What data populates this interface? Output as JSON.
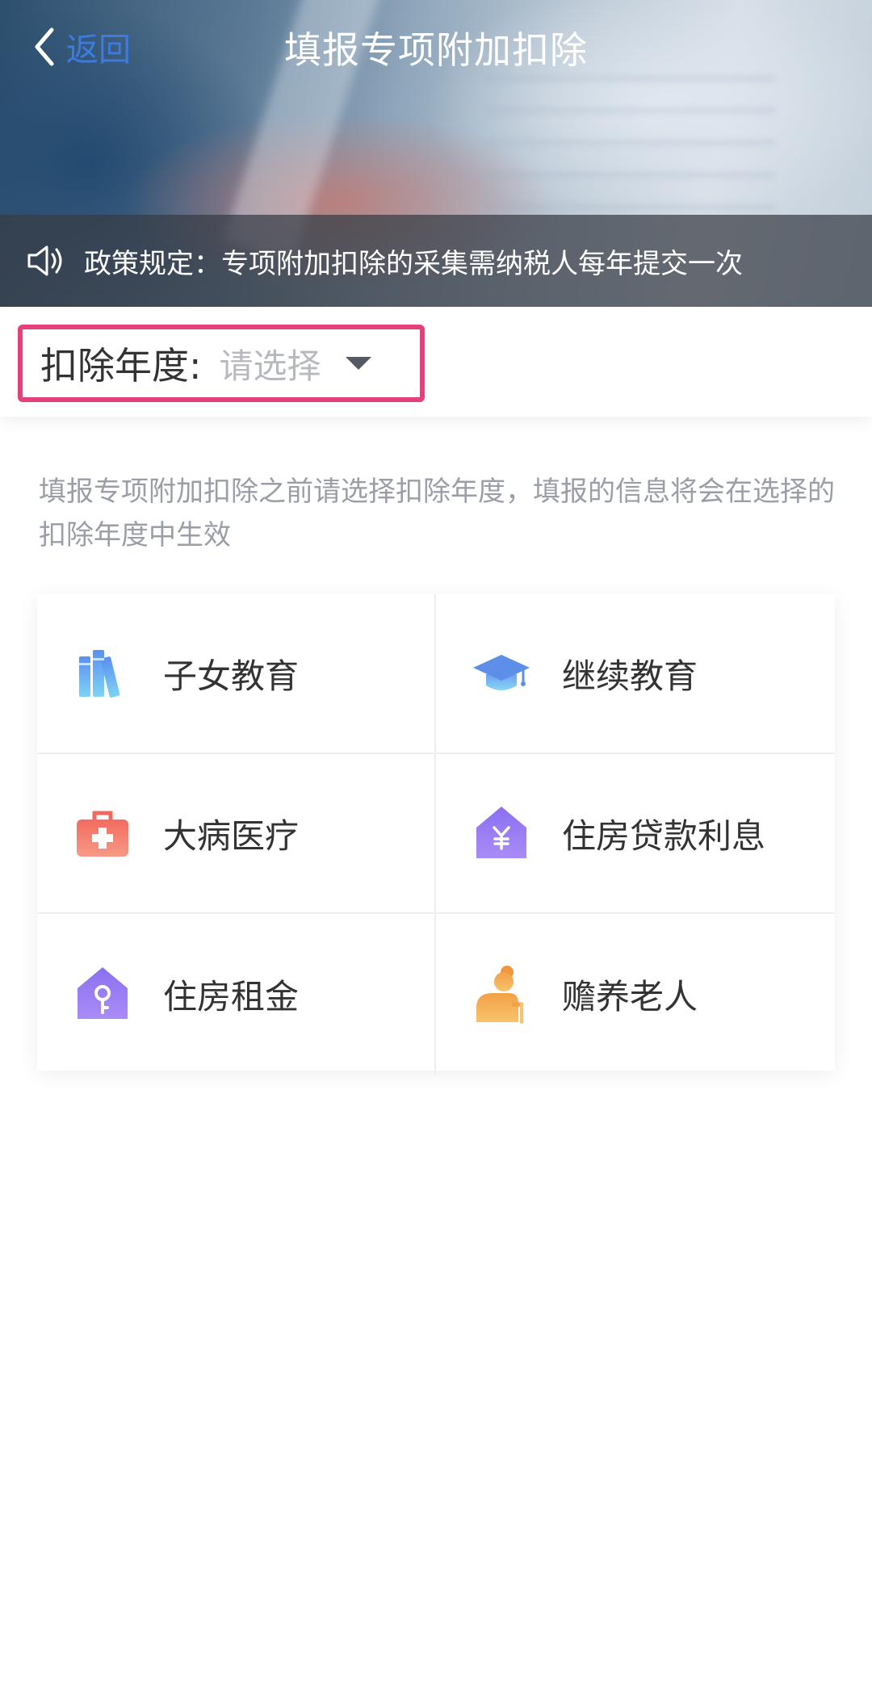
{
  "header": {
    "back_label": "返回",
    "title": "填报专项附加扣除"
  },
  "notice": {
    "icon": "speaker-icon",
    "text": "政策规定：专项附加扣除的采集需纳税人每年提交一次"
  },
  "year_selector": {
    "label": "扣除年度:",
    "placeholder": "请选择",
    "highlight_color": "#e2417c"
  },
  "hint": "填报专项附加扣除之前请选择扣除年度，填报的信息将会在选择的扣除年度中生效",
  "categories": [
    {
      "label": "子女教育",
      "icon": "books-icon"
    },
    {
      "label": "继续教育",
      "icon": "graduation-cap-icon"
    },
    {
      "label": "大病医疗",
      "icon": "medical-kit-icon"
    },
    {
      "label": "住房贷款利息",
      "icon": "house-yuan-icon"
    },
    {
      "label": "住房租金",
      "icon": "house-key-icon"
    },
    {
      "label": "赡养老人",
      "icon": "elderly-person-icon"
    }
  ],
  "colors": {
    "accent_blue": "#3d7be0",
    "text_primary": "#333333",
    "text_secondary": "#9a9ea6"
  }
}
